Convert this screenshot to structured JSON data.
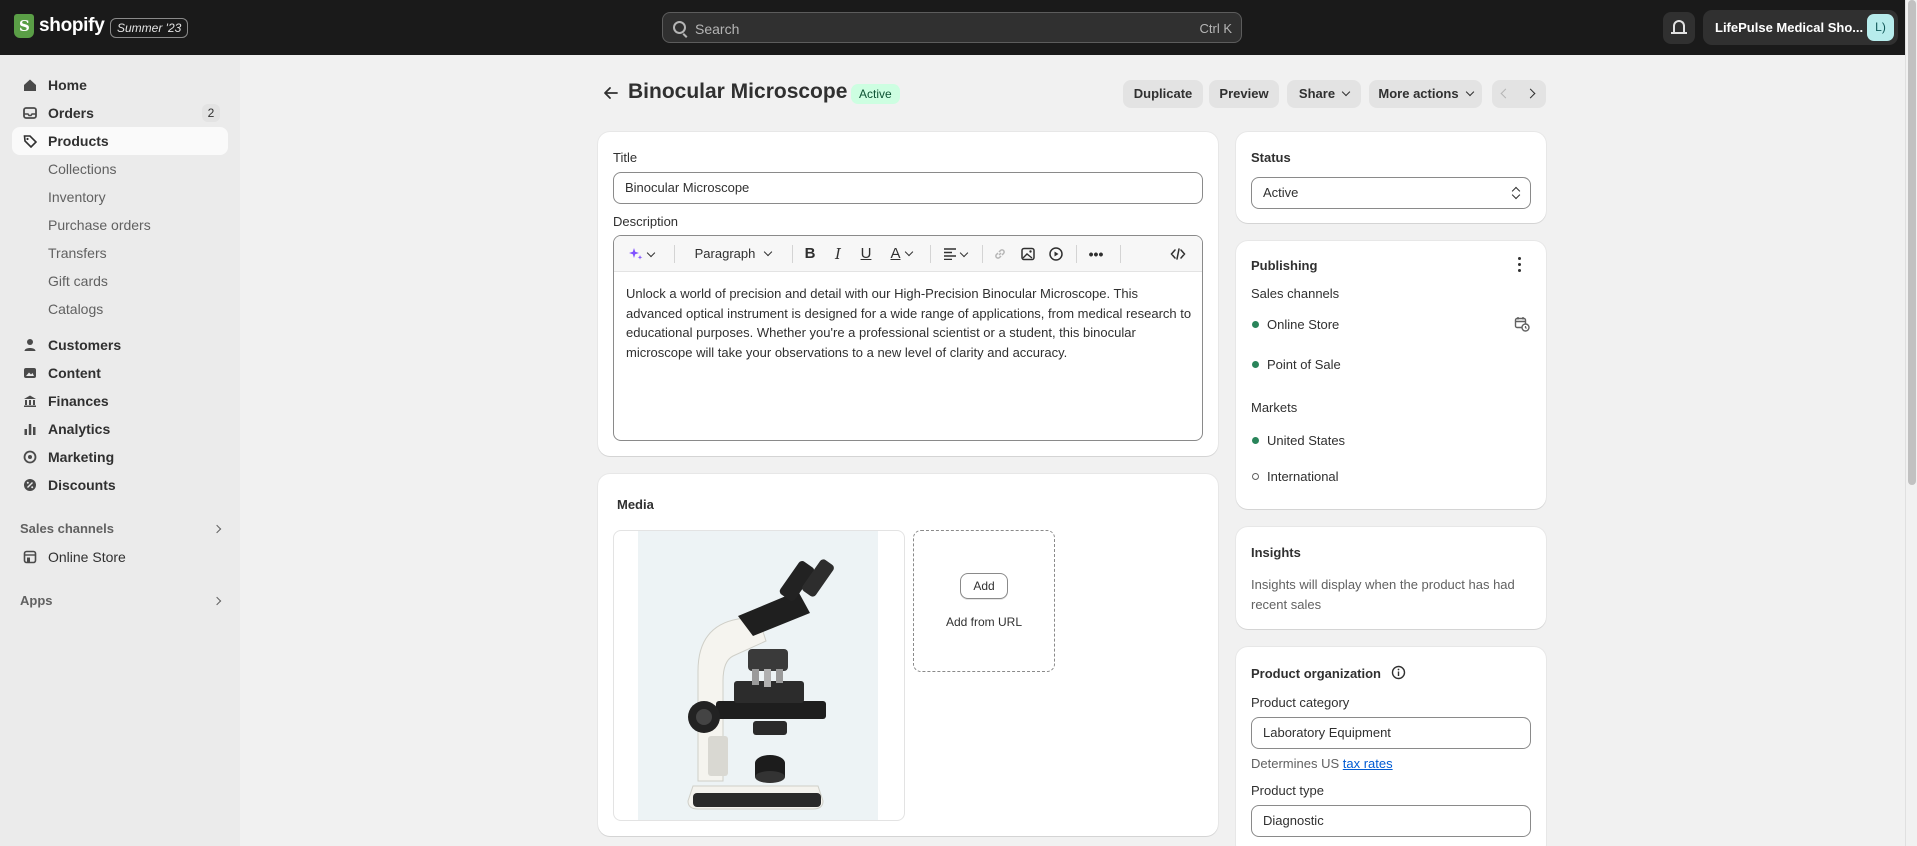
{
  "topbar": {
    "brand": "shopify",
    "edition": "Summer '23",
    "search_placeholder": "Search",
    "search_shortcut": "Ctrl K",
    "store_name": "LifePulse Medical Sho...",
    "avatar_initials": "L)"
  },
  "sidebar": {
    "items": [
      {
        "label": "Home",
        "icon": "home-icon"
      },
      {
        "label": "Orders",
        "icon": "orders-icon",
        "badge": "2"
      },
      {
        "label": "Products",
        "icon": "tag-icon",
        "active": true
      }
    ],
    "product_subitems": [
      "Collections",
      "Inventory",
      "Purchase orders",
      "Transfers",
      "Gift cards",
      "Catalogs"
    ],
    "more_items": [
      {
        "label": "Customers",
        "icon": "person-icon"
      },
      {
        "label": "Content",
        "icon": "content-icon"
      },
      {
        "label": "Finances",
        "icon": "bank-icon"
      },
      {
        "label": "Analytics",
        "icon": "chart-icon"
      },
      {
        "label": "Marketing",
        "icon": "target-icon"
      },
      {
        "label": "Discounts",
        "icon": "discount-icon"
      }
    ],
    "sales_channels_heading": "Sales channels",
    "online_store": "Online Store",
    "apps_heading": "Apps"
  },
  "header": {
    "title": "Binocular Microscope",
    "status": "Active",
    "duplicate": "Duplicate",
    "preview": "Preview",
    "share": "Share",
    "more_actions": "More actions"
  },
  "product": {
    "title_label": "Title",
    "title_value": "Binocular Microscope",
    "description_label": "Description",
    "format_select": "Paragraph",
    "description": "Unlock a world of precision and detail with our High-Precision Binocular Microscope. This advanced optical instrument is designed for a wide range of applications, from medical research to educational purposes. Whether you're a professional scientist or a student, this binocular microscope will take your observations to a new level of clarity and accuracy."
  },
  "media": {
    "heading": "Media",
    "add_button": "Add",
    "add_from_url": "Add from URL"
  },
  "status_card": {
    "heading": "Status",
    "value": "Active"
  },
  "publishing": {
    "heading": "Publishing",
    "sales_channels_label": "Sales channels",
    "channels": [
      "Online Store",
      "Point of Sale"
    ],
    "markets_label": "Markets",
    "markets": [
      {
        "name": "United States",
        "active": true
      },
      {
        "name": "International",
        "active": false
      }
    ]
  },
  "insights": {
    "heading": "Insights",
    "text": "Insights will display when the product has had recent sales"
  },
  "organization": {
    "heading": "Product organization",
    "category_label": "Product category",
    "category_value": "Laboratory Equipment",
    "tax_note_prefix": "Determines US",
    "tax_link": "tax rates",
    "type_label": "Product type",
    "type_value": "Diagnostic"
  },
  "colors": {
    "topbar": "#1a1a1a",
    "active_badge_bg": "#cdfee1",
    "active_dot": "#29845a",
    "link": "#005bd3"
  }
}
